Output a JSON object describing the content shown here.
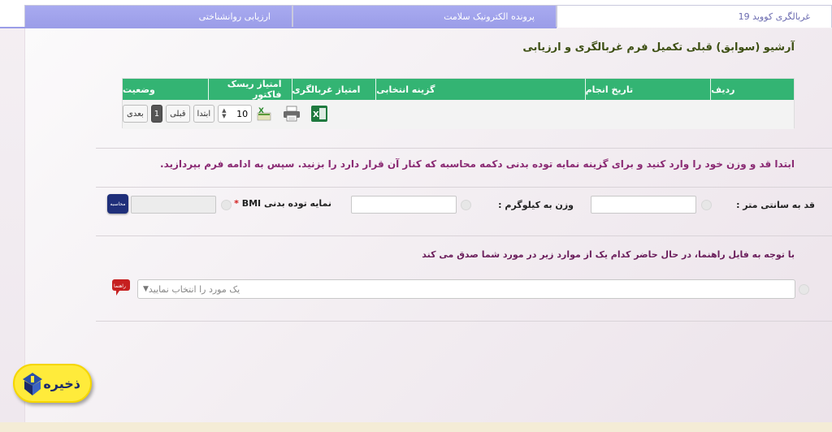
{
  "tabs": [
    {
      "label": "غربالگری کووید 19",
      "active": true
    },
    {
      "label": "پرونده الکترونیک سلامت",
      "active": false
    },
    {
      "label": "ارزیابی روانشناختی",
      "active": false
    }
  ],
  "archive_title": "آرشیو (سوابق) قبلی تکمیل فرم غربالگری و ارزیابی",
  "grid": {
    "columns": [
      "ردیف",
      "تاریخ انجام",
      "گزینه انتخابی",
      "امتیاز غربالگری",
      "امتیاز ریسک فاکتور",
      "وضعیت"
    ],
    "pager": {
      "next_label": "بعدی",
      "current_page": "1",
      "prev_label": "قبلی",
      "first_label": "ابتدا",
      "page_size": "10"
    },
    "icons": [
      "excel-export-icon",
      "print-icon",
      "excel-icon"
    ]
  },
  "instruction": "ابتدا قد و وزن خود را وارد کنید و برای گزینه نمایه توده بدنی دکمه محاسبه که کنار آن قرار دارد را بزنید. سپس به ادامه فرم بپردازید.",
  "form": {
    "height_label": "قد به سانتی متر :",
    "height_value": "",
    "weight_label": "وزن به کیلوگرم :",
    "weight_value": "",
    "bmi_label": "نمایه توده بدنی BMI",
    "bmi_required": "*",
    "bmi_value": "",
    "calc_label": "محاسبه"
  },
  "question": {
    "text": "با توجه به فایل راهنما، در حال حاضر کدام یک از موارد زیر در مورد شما صدق می کند",
    "select_placeholder": "یک مورد را انتخاب نمایید",
    "guide_label": "راهنما"
  },
  "save_label": "ذخیره",
  "colors": {
    "tab_inactive": "#9b9de8",
    "grid_header": "#33b473",
    "title_green": "#3d4f13",
    "instruction_purple": "#8a2a73",
    "save_yellow": "#ffeb3b"
  }
}
